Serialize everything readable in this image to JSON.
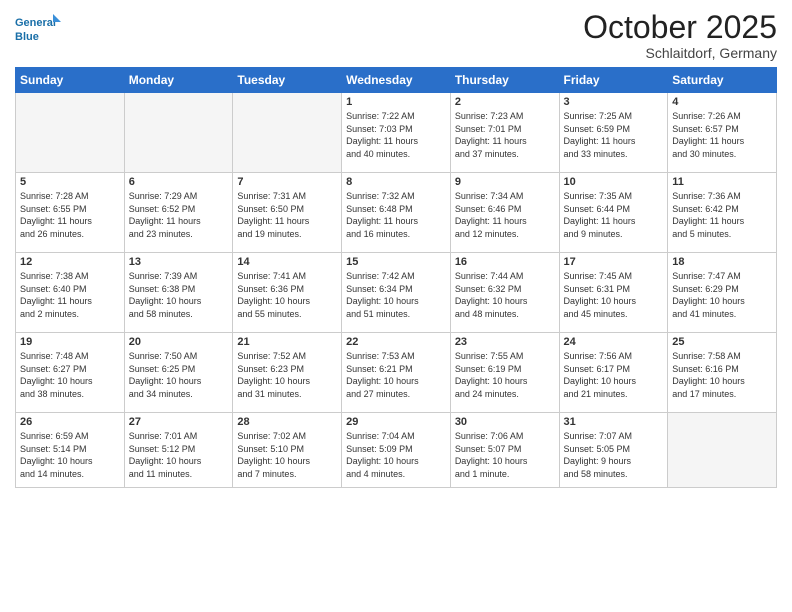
{
  "header": {
    "logo_line1": "General",
    "logo_line2": "Blue",
    "month_title": "October 2025",
    "location": "Schlaitdorf, Germany"
  },
  "weekdays": [
    "Sunday",
    "Monday",
    "Tuesday",
    "Wednesday",
    "Thursday",
    "Friday",
    "Saturday"
  ],
  "weeks": [
    [
      {
        "day": "",
        "info": ""
      },
      {
        "day": "",
        "info": ""
      },
      {
        "day": "",
        "info": ""
      },
      {
        "day": "1",
        "info": "Sunrise: 7:22 AM\nSunset: 7:03 PM\nDaylight: 11 hours\nand 40 minutes."
      },
      {
        "day": "2",
        "info": "Sunrise: 7:23 AM\nSunset: 7:01 PM\nDaylight: 11 hours\nand 37 minutes."
      },
      {
        "day": "3",
        "info": "Sunrise: 7:25 AM\nSunset: 6:59 PM\nDaylight: 11 hours\nand 33 minutes."
      },
      {
        "day": "4",
        "info": "Sunrise: 7:26 AM\nSunset: 6:57 PM\nDaylight: 11 hours\nand 30 minutes."
      }
    ],
    [
      {
        "day": "5",
        "info": "Sunrise: 7:28 AM\nSunset: 6:55 PM\nDaylight: 11 hours\nand 26 minutes."
      },
      {
        "day": "6",
        "info": "Sunrise: 7:29 AM\nSunset: 6:52 PM\nDaylight: 11 hours\nand 23 minutes."
      },
      {
        "day": "7",
        "info": "Sunrise: 7:31 AM\nSunset: 6:50 PM\nDaylight: 11 hours\nand 19 minutes."
      },
      {
        "day": "8",
        "info": "Sunrise: 7:32 AM\nSunset: 6:48 PM\nDaylight: 11 hours\nand 16 minutes."
      },
      {
        "day": "9",
        "info": "Sunrise: 7:34 AM\nSunset: 6:46 PM\nDaylight: 11 hours\nand 12 minutes."
      },
      {
        "day": "10",
        "info": "Sunrise: 7:35 AM\nSunset: 6:44 PM\nDaylight: 11 hours\nand 9 minutes."
      },
      {
        "day": "11",
        "info": "Sunrise: 7:36 AM\nSunset: 6:42 PM\nDaylight: 11 hours\nand 5 minutes."
      }
    ],
    [
      {
        "day": "12",
        "info": "Sunrise: 7:38 AM\nSunset: 6:40 PM\nDaylight: 11 hours\nand 2 minutes."
      },
      {
        "day": "13",
        "info": "Sunrise: 7:39 AM\nSunset: 6:38 PM\nDaylight: 10 hours\nand 58 minutes."
      },
      {
        "day": "14",
        "info": "Sunrise: 7:41 AM\nSunset: 6:36 PM\nDaylight: 10 hours\nand 55 minutes."
      },
      {
        "day": "15",
        "info": "Sunrise: 7:42 AM\nSunset: 6:34 PM\nDaylight: 10 hours\nand 51 minutes."
      },
      {
        "day": "16",
        "info": "Sunrise: 7:44 AM\nSunset: 6:32 PM\nDaylight: 10 hours\nand 48 minutes."
      },
      {
        "day": "17",
        "info": "Sunrise: 7:45 AM\nSunset: 6:31 PM\nDaylight: 10 hours\nand 45 minutes."
      },
      {
        "day": "18",
        "info": "Sunrise: 7:47 AM\nSunset: 6:29 PM\nDaylight: 10 hours\nand 41 minutes."
      }
    ],
    [
      {
        "day": "19",
        "info": "Sunrise: 7:48 AM\nSunset: 6:27 PM\nDaylight: 10 hours\nand 38 minutes."
      },
      {
        "day": "20",
        "info": "Sunrise: 7:50 AM\nSunset: 6:25 PM\nDaylight: 10 hours\nand 34 minutes."
      },
      {
        "day": "21",
        "info": "Sunrise: 7:52 AM\nSunset: 6:23 PM\nDaylight: 10 hours\nand 31 minutes."
      },
      {
        "day": "22",
        "info": "Sunrise: 7:53 AM\nSunset: 6:21 PM\nDaylight: 10 hours\nand 27 minutes."
      },
      {
        "day": "23",
        "info": "Sunrise: 7:55 AM\nSunset: 6:19 PM\nDaylight: 10 hours\nand 24 minutes."
      },
      {
        "day": "24",
        "info": "Sunrise: 7:56 AM\nSunset: 6:17 PM\nDaylight: 10 hours\nand 21 minutes."
      },
      {
        "day": "25",
        "info": "Sunrise: 7:58 AM\nSunset: 6:16 PM\nDaylight: 10 hours\nand 17 minutes."
      }
    ],
    [
      {
        "day": "26",
        "info": "Sunrise: 6:59 AM\nSunset: 5:14 PM\nDaylight: 10 hours\nand 14 minutes."
      },
      {
        "day": "27",
        "info": "Sunrise: 7:01 AM\nSunset: 5:12 PM\nDaylight: 10 hours\nand 11 minutes."
      },
      {
        "day": "28",
        "info": "Sunrise: 7:02 AM\nSunset: 5:10 PM\nDaylight: 10 hours\nand 7 minutes."
      },
      {
        "day": "29",
        "info": "Sunrise: 7:04 AM\nSunset: 5:09 PM\nDaylight: 10 hours\nand 4 minutes."
      },
      {
        "day": "30",
        "info": "Sunrise: 7:06 AM\nSunset: 5:07 PM\nDaylight: 10 hours\nand 1 minute."
      },
      {
        "day": "31",
        "info": "Sunrise: 7:07 AM\nSunset: 5:05 PM\nDaylight: 9 hours\nand 58 minutes."
      },
      {
        "day": "",
        "info": ""
      }
    ]
  ]
}
